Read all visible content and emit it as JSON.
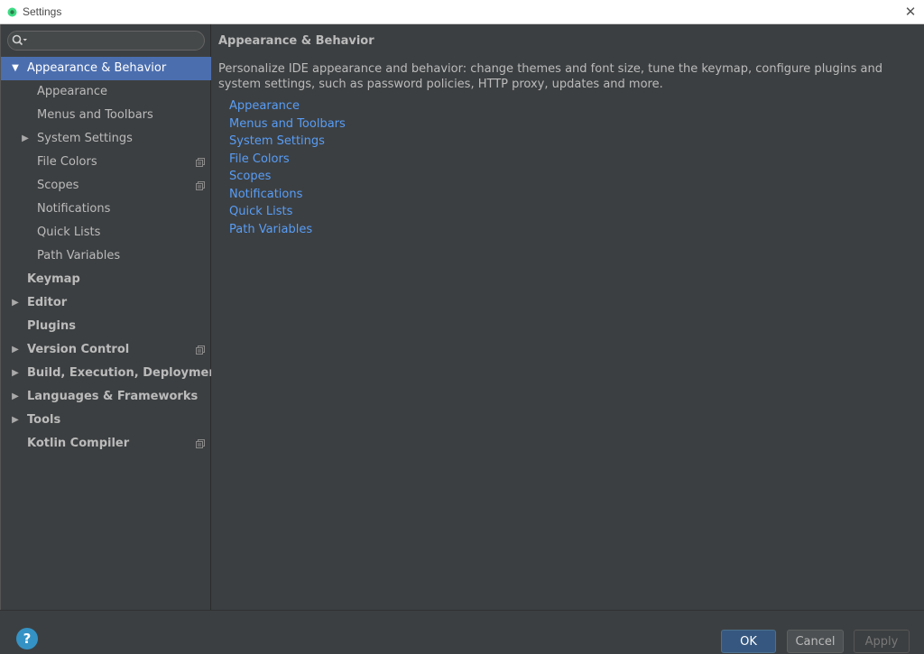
{
  "window": {
    "title": "Settings",
    "close_glyph": "✕"
  },
  "search": {
    "value": "",
    "placeholder": ""
  },
  "tree": [
    {
      "label": "Appearance & Behavior",
      "level": 0,
      "expandable": true,
      "expanded": true,
      "selected": true,
      "has_config_icon": false,
      "name": "tree-item-appearance-behavior"
    },
    {
      "label": "Appearance",
      "level": 1,
      "expandable": false,
      "selected": false,
      "has_config_icon": false,
      "name": "tree-item-appearance"
    },
    {
      "label": "Menus and Toolbars",
      "level": 1,
      "expandable": false,
      "selected": false,
      "has_config_icon": false,
      "name": "tree-item-menus-and-toolbars"
    },
    {
      "label": "System Settings",
      "level": 1,
      "expandable": true,
      "expanded": false,
      "selected": false,
      "has_config_icon": false,
      "name": "tree-item-system-settings"
    },
    {
      "label": "File Colors",
      "level": 1,
      "expandable": false,
      "selected": false,
      "has_config_icon": true,
      "name": "tree-item-file-colors"
    },
    {
      "label": "Scopes",
      "level": 1,
      "expandable": false,
      "selected": false,
      "has_config_icon": true,
      "name": "tree-item-scopes"
    },
    {
      "label": "Notifications",
      "level": 1,
      "expandable": false,
      "selected": false,
      "has_config_icon": false,
      "name": "tree-item-notifications"
    },
    {
      "label": "Quick Lists",
      "level": 1,
      "expandable": false,
      "selected": false,
      "has_config_icon": false,
      "name": "tree-item-quick-lists"
    },
    {
      "label": "Path Variables",
      "level": 1,
      "expandable": false,
      "selected": false,
      "has_config_icon": false,
      "name": "tree-item-path-variables"
    },
    {
      "label": "Keymap",
      "level": 0,
      "expandable": false,
      "selected": false,
      "has_config_icon": false,
      "name": "tree-item-keymap"
    },
    {
      "label": "Editor",
      "level": 0,
      "expandable": true,
      "expanded": false,
      "selected": false,
      "has_config_icon": false,
      "name": "tree-item-editor"
    },
    {
      "label": "Plugins",
      "level": 0,
      "expandable": false,
      "selected": false,
      "has_config_icon": false,
      "name": "tree-item-plugins"
    },
    {
      "label": "Version Control",
      "level": 0,
      "expandable": true,
      "expanded": false,
      "selected": false,
      "has_config_icon": true,
      "name": "tree-item-version-control"
    },
    {
      "label": "Build, Execution, Deployment",
      "level": 0,
      "expandable": true,
      "expanded": false,
      "selected": false,
      "has_config_icon": false,
      "name": "tree-item-build-execution-deployment"
    },
    {
      "label": "Languages & Frameworks",
      "level": 0,
      "expandable": true,
      "expanded": false,
      "selected": false,
      "has_config_icon": false,
      "name": "tree-item-languages-frameworks"
    },
    {
      "label": "Tools",
      "level": 0,
      "expandable": true,
      "expanded": false,
      "selected": false,
      "has_config_icon": false,
      "name": "tree-item-tools"
    },
    {
      "label": "Kotlin Compiler",
      "level": 0,
      "expandable": false,
      "selected": false,
      "has_config_icon": true,
      "name": "tree-item-kotlin-compiler"
    }
  ],
  "content": {
    "title": "Appearance & Behavior",
    "description": "Personalize IDE appearance and behavior: change themes and font size, tune the keymap, configure plugins and system settings, such as password policies, HTTP proxy, updates and more.",
    "links": [
      {
        "label": "Appearance",
        "name": "link-appearance"
      },
      {
        "label": "Menus and Toolbars",
        "name": "link-menus-and-toolbars"
      },
      {
        "label": "System Settings",
        "name": "link-system-settings"
      },
      {
        "label": "File Colors",
        "name": "link-file-colors"
      },
      {
        "label": "Scopes",
        "name": "link-scopes"
      },
      {
        "label": "Notifications",
        "name": "link-notifications"
      },
      {
        "label": "Quick Lists",
        "name": "link-quick-lists"
      },
      {
        "label": "Path Variables",
        "name": "link-path-variables"
      }
    ]
  },
  "footer": {
    "help_label": "?",
    "ok_label": "OK",
    "cancel_label": "Cancel",
    "apply_label": "Apply"
  },
  "colors": {
    "background": "#3c3f41",
    "selection": "#4b6eaf",
    "link": "#589df6",
    "text": "#bbbbbb",
    "ok_button": "#365880",
    "help_icon": "#3592c4"
  },
  "icons": {
    "app": "android-studio-icon",
    "search": "search-icon",
    "expand": "triangle-right-icon",
    "collapse": "triangle-down-icon",
    "project_config": "project-config-icon"
  }
}
